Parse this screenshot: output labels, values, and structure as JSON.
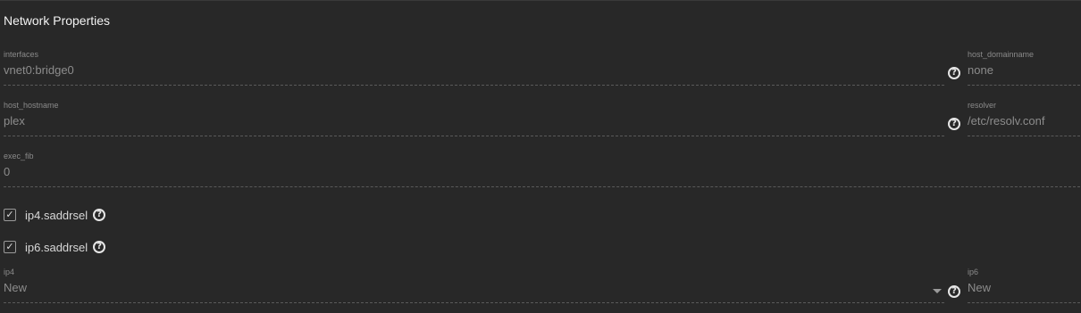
{
  "section": {
    "title": "Network Properties"
  },
  "fields": {
    "interfaces": {
      "label": "interfaces",
      "value": "vnet0:bridge0"
    },
    "host_domainname": {
      "label": "host_domainname",
      "value": "none"
    },
    "host_hostname": {
      "label": "host_hostname",
      "value": "plex"
    },
    "resolver": {
      "label": "resolver",
      "value": "/etc/resolv.conf"
    },
    "exec_fib": {
      "label": "exec_fib",
      "value": "0"
    },
    "ip4": {
      "label": "ip4",
      "value": "New"
    },
    "ip6": {
      "label": "ip6",
      "value": "New"
    }
  },
  "checkboxes": {
    "ip4_saddrsel": {
      "label": "ip4.saddrsel",
      "checked": true
    },
    "ip6_saddrsel": {
      "label": "ip6.saddrsel",
      "checked": true
    }
  },
  "icons": {
    "help": "question-circle-icon",
    "check": "check-icon",
    "dropdown": "caret-down-icon"
  },
  "glyphs": {
    "help": "?",
    "check": "✓"
  },
  "colors": {
    "background": "#282828",
    "text": "#cfcfcf",
    "muted": "#8c8c8c",
    "divider": "#5a5a5a"
  }
}
